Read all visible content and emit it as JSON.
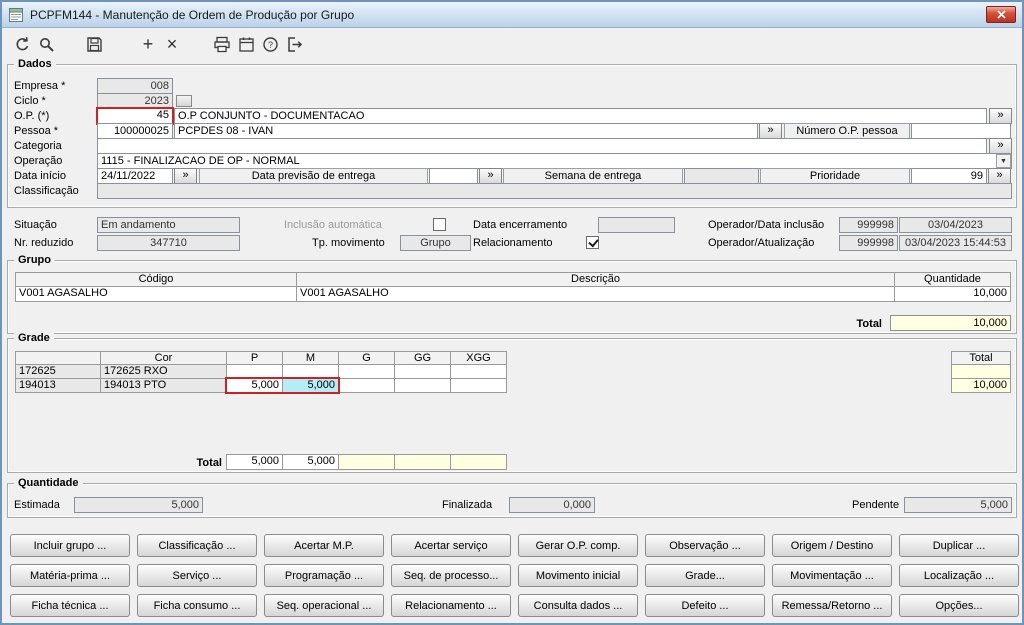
{
  "colors": {
    "highlight_red": "#cc2222",
    "selected_cell_cyan": "#b4ecf7",
    "total_yellow": "#ffffe1",
    "titlebar_blue": "#bcd2e8"
  },
  "window": {
    "title": "PCPFM144 - Manutenção de Ordem de Produção por Grupo"
  },
  "toolbar": {
    "icons": [
      "undo",
      "search",
      "save",
      "add",
      "delete",
      "print",
      "calendar",
      "help",
      "exit"
    ],
    "add_glyph": "+",
    "delete_glyph": "×"
  },
  "dados": {
    "legend": "Dados",
    "nav_glyph": "»",
    "empresa_label": "Empresa *",
    "empresa_value": "008",
    "ciclo_label": "Ciclo *",
    "ciclo_value": "2023",
    "op_label": "O.P. (*)",
    "op_value": "45",
    "op_descricao": "O.P CONJUNTO - DOCUMENTACAO",
    "pessoa_label": "Pessoa *",
    "pessoa_value": "100000025",
    "pessoa_nome": "PCPDES 08 - IVAN",
    "numero_op_pessoa_label": "Número O.P. pessoa",
    "numero_op_pessoa_value": "",
    "categoria_label": "Categoria",
    "categoria_value": "",
    "operacao_label": "Operação",
    "operacao_value": "1115 - FINALIZACAO DE OP - NORMAL",
    "data_inicio_label": "Data início",
    "data_inicio_value": "24/11/2022",
    "data_previsao_label": "Data previsão de entrega",
    "data_previsao_value": "",
    "semana_entrega_label": "Semana de entrega",
    "semana_entrega_value": "",
    "prioridade_label": "Prioridade",
    "prioridade_value": "99",
    "classificacao_label": "Classificação",
    "classificacao_value": ""
  },
  "status": {
    "situacao_label": "Situação",
    "situacao_value": "Em andamento",
    "inclusao_automatica_label": "Inclusão automática",
    "inclusao_automatica_checked": false,
    "data_encerramento_label": "Data encerramento",
    "data_encerramento_value": "",
    "operador_inclusao_label": "Operador/Data inclusão",
    "operador_inclusao_num": "999998",
    "operador_inclusao_data": "03/04/2023",
    "nr_reduzido_label": "Nr. reduzido",
    "nr_reduzido_value": "347710",
    "tp_movimento_label": "Tp. movimento",
    "tp_movimento_value": "Grupo",
    "relacionamento_label": "Relacionamento",
    "relacionamento_checked": true,
    "operador_atualizacao_label": "Operador/Atualização",
    "operador_atualizacao_num": "999998",
    "operador_atualizacao_data": "03/04/2023 15:44:53"
  },
  "grupo": {
    "legend": "Grupo",
    "headers": [
      "Código",
      "Descrição",
      "Quantidade"
    ],
    "rows": [
      {
        "codigo": "V001 AGASALHO",
        "descricao": "V001 AGASALHO",
        "quantidade": "10,000"
      }
    ],
    "total_label": "Total",
    "total_value": "10,000"
  },
  "grade": {
    "legend": "Grade",
    "cor_header": "Cor",
    "size_headers": [
      "P",
      "M",
      "G",
      "GG",
      "XGG"
    ],
    "total_header": "Total",
    "rows": [
      {
        "codigo": "172625",
        "cor": "172625 RXO",
        "values": [
          "",
          "",
          "",
          "",
          ""
        ],
        "total": ""
      },
      {
        "codigo": "194013",
        "cor": "194013 PTO",
        "values": [
          "5,000",
          "5,000",
          "",
          "",
          ""
        ],
        "total": "10,000"
      }
    ],
    "total_label": "Total",
    "column_totals": [
      "5,000",
      "5,000",
      "",
      "",
      ""
    ]
  },
  "quantidade": {
    "legend": "Quantidade",
    "estimada_label": "Estimada",
    "estimada_value": "5,000",
    "finalizada_label": "Finalizada",
    "finalizada_value": "0,000",
    "pendente_label": "Pendente",
    "pendente_value": "5,000"
  },
  "buttons": [
    [
      "Incluir grupo ...",
      "Classificação ...",
      "Acertar M.P.",
      "Acertar serviço",
      "Gerar O.P. comp.",
      "Observação ...",
      "Origem / Destino",
      "Duplicar ..."
    ],
    [
      "Matéria-prima ...",
      "Serviço ...",
      "Programação ...",
      "Seq. de processo...",
      "Movimento inicial",
      "Grade...",
      "Movimentação ...",
      "Localização ..."
    ],
    [
      "Ficha técnica ...",
      "Ficha consumo ...",
      "Seq. operacional ...",
      "Relacionamento ...",
      "Consulta dados ...",
      "Defeito ...",
      "Remessa/Retorno ...",
      "Opções..."
    ]
  ]
}
